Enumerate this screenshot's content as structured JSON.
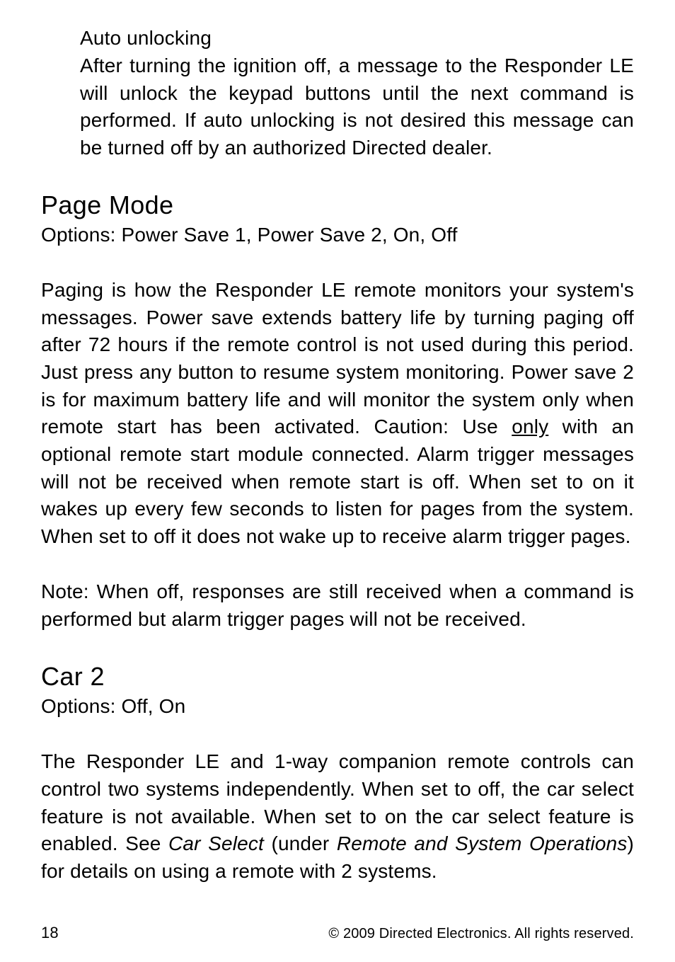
{
  "auto_unlocking": {
    "heading": "Auto unlocking",
    "body": "After turning the ignition off, a message to the Responder LE will unlock the keypad buttons until the next command is performed. If auto unlocking is not desired this message can be turned off by an authorized Directed dealer."
  },
  "page_mode": {
    "heading": "Page Mode",
    "options": "Options: Power Save 1, Power Save 2, On, Off",
    "body_part1": "Paging is how the Responder LE remote monitors your system's messages. Power save extends battery life by turning paging off after 72 hours if the remote control is not used during this period. Just press any button to resume system monitoring. Power save 2 is for maximum battery life and will monitor the system only when remote start has been activated. ",
    "caution_label": "Caution:",
    "body_part2": " Use ",
    "only_word": "only",
    "body_part3": " with an optional remote start module connected. Alarm trigger messages will not be received when remote start is off. When set to on it wakes up every few seconds to listen for pages from the system. When set to off it does not wake up to receive alarm trigger pages.",
    "note": "Note: When off, responses are still received when a command is performed but alarm trigger pages will not be received."
  },
  "car2": {
    "heading": "Car 2",
    "options": "Options: Off, On",
    "body_part1": "The Responder LE and 1-way companion remote controls can control two systems independently. When set to off, the car select feature is not available. When set to on the car select feature is enabled. See ",
    "car_select_italic": "Car Select",
    "body_part2": " (under ",
    "remote_ops_italic": "Remote and System Operations",
    "body_part3": ") for details on using a remote with 2 systems."
  },
  "footer": {
    "page_number": "18",
    "copyright": "© 2009 Directed Electronics. All rights reserved."
  }
}
